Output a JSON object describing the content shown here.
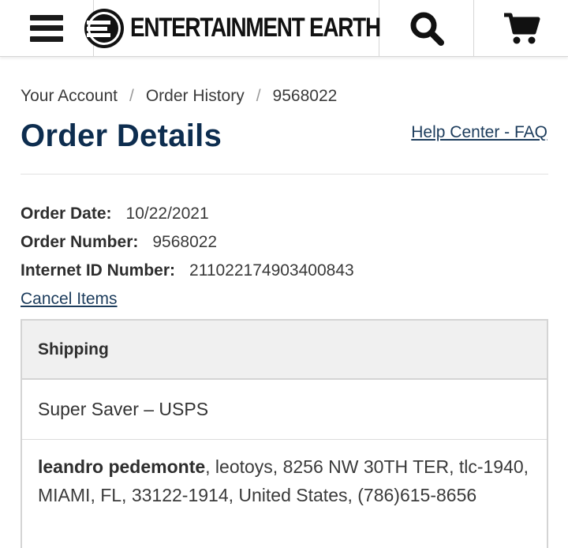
{
  "header": {
    "logo_text": "ENTERTAINMENT EARTH"
  },
  "breadcrumb": {
    "items": [
      "Your Account",
      "Order History",
      "9568022"
    ],
    "separator": "/"
  },
  "page": {
    "title": "Order Details",
    "help_link": "Help Center - FAQ"
  },
  "order": {
    "date_label": "Order Date:",
    "date_value": "10/22/2021",
    "number_label": "Order Number:",
    "number_value": "9568022",
    "internet_id_label": "Internet ID Number:",
    "internet_id_value": "211022174903400843",
    "cancel_link": "Cancel Items"
  },
  "shipping": {
    "header": "Shipping",
    "method": "Super Saver – USPS",
    "recipient_name": "leandro pedemonte",
    "address_rest": ", leotoys, 8256 NW 30TH TER, tlc-1940, MIAMI, FL, 33122-1914, United States, (786)615-8656"
  },
  "colors": {
    "title": "#0d2d4f",
    "link": "#1c3c5c",
    "panel_header_bg": "#f0f0f0",
    "border": "#d4d4d4"
  },
  "icons": {
    "menu": "hamburger-menu-icon",
    "search": "search-icon",
    "cart": "shopping-cart-icon",
    "logo": "entertainment-earth-logo-mark"
  }
}
